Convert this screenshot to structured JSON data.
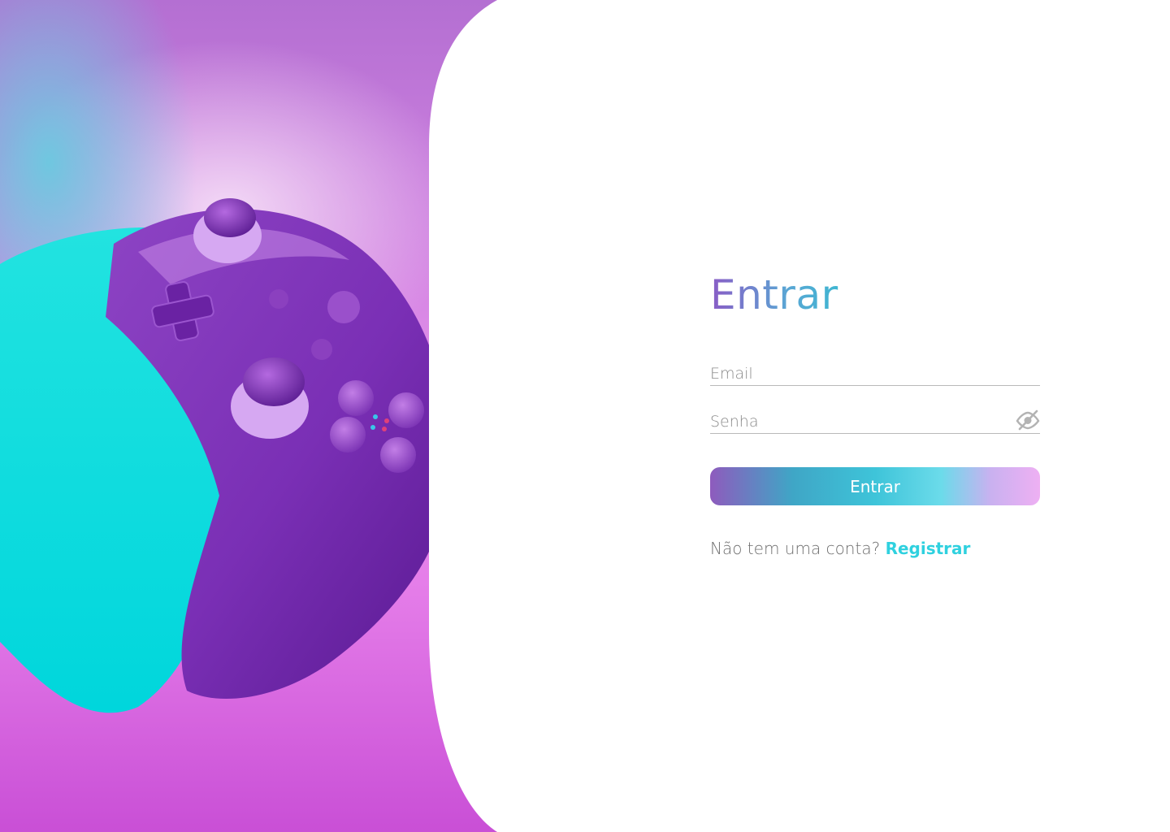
{
  "login": {
    "title": "Entrar",
    "email_placeholder": "Email",
    "password_placeholder": "Senha",
    "password_toggle_icon": "eye-slash-icon",
    "submit_label": "Entrar",
    "no_account_text": "Não tem uma conta?",
    "register_link": "Registrar"
  },
  "hero": {
    "image": "purple-and-cyan-game-controller"
  },
  "colors": {
    "title_gradient_start": "#8a5cc6",
    "title_gradient_end": "#3fb6d2",
    "link": "#2fd1df",
    "button_gradient_start": "#8e5bbd",
    "button_gradient_end": "#eeb0f3"
  }
}
